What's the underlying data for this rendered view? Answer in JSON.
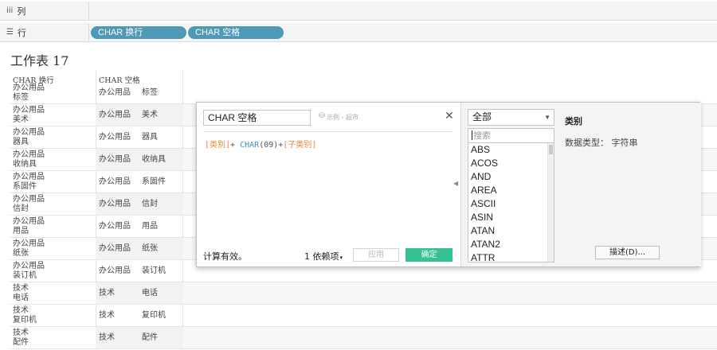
{
  "shelves": {
    "columns": {
      "icon": "columns-shelf-icon",
      "label": "列"
    },
    "rows": {
      "icon": "rows-shelf-icon",
      "label": "行",
      "pills": [
        "CHAR 换行",
        "CHAR 空格"
      ]
    }
  },
  "worksheet": {
    "title": "工作表 17",
    "headers": [
      "CHAR 换行",
      "CHAR 空格"
    ],
    "rows": [
      {
        "c1a": "办公用品",
        "c1b": "标签",
        "c2a": "办公用品",
        "c2b": "标签"
      },
      {
        "c1a": "办公用品",
        "c1b": "美术",
        "c2a": "办公用品",
        "c2b": "美术"
      },
      {
        "c1a": "办公用品",
        "c1b": "器具",
        "c2a": "办公用品",
        "c2b": "器具"
      },
      {
        "c1a": "办公用品",
        "c1b": "收纳具",
        "c2a": "办公用品",
        "c2b": "收纳具"
      },
      {
        "c1a": "办公用品",
        "c1b": "系固件",
        "c2a": "办公用品",
        "c2b": "系固件"
      },
      {
        "c1a": "办公用品",
        "c1b": "信封",
        "c2a": "办公用品",
        "c2b": "信封"
      },
      {
        "c1a": "办公用品",
        "c1b": "用品",
        "c2a": "办公用品",
        "c2b": "用品"
      },
      {
        "c1a": "办公用品",
        "c1b": "纸张",
        "c2a": "办公用品",
        "c2b": "纸张"
      },
      {
        "c1a": "办公用品",
        "c1b": "装订机",
        "c2a": "办公用品",
        "c2b": "装订机"
      },
      {
        "c1a": "技术",
        "c1b": "电话",
        "c2a": "技术",
        "c2b": "电话"
      },
      {
        "c1a": "技术",
        "c1b": "复印机",
        "c2a": "技术",
        "c2b": "复印机"
      },
      {
        "c1a": "技术",
        "c1b": "配件",
        "c2a": "技术",
        "c2b": "配件"
      }
    ]
  },
  "dialog": {
    "name": "CHAR 空格",
    "datasource_icon": "database-icon",
    "datasource": "示例 - 超市",
    "close_icon": "close-icon",
    "formula": {
      "field1": "[类别]",
      "plus1": "+ ",
      "fn": "CHAR",
      "args": "(09)",
      "plus2": "+",
      "field2": "[子类别]"
    },
    "status": "计算有效。",
    "dependencies": "1 依赖项",
    "apply_label": "应用",
    "ok_label": "确定",
    "category": "全部",
    "search_placeholder": "搜索",
    "functions": [
      "ABS",
      "ACOS",
      "AND",
      "AREA",
      "ASCII",
      "ASIN",
      "ATAN",
      "ATAN2",
      "ATTR"
    ],
    "help_title": "类别",
    "help_type": "数据类型： 字符串",
    "describe_label": "描述(D)...",
    "colors": {
      "pill": "#4e99b5",
      "ok": "#35c095",
      "field": "#e38a3d",
      "function": "#3d8fc0"
    }
  }
}
